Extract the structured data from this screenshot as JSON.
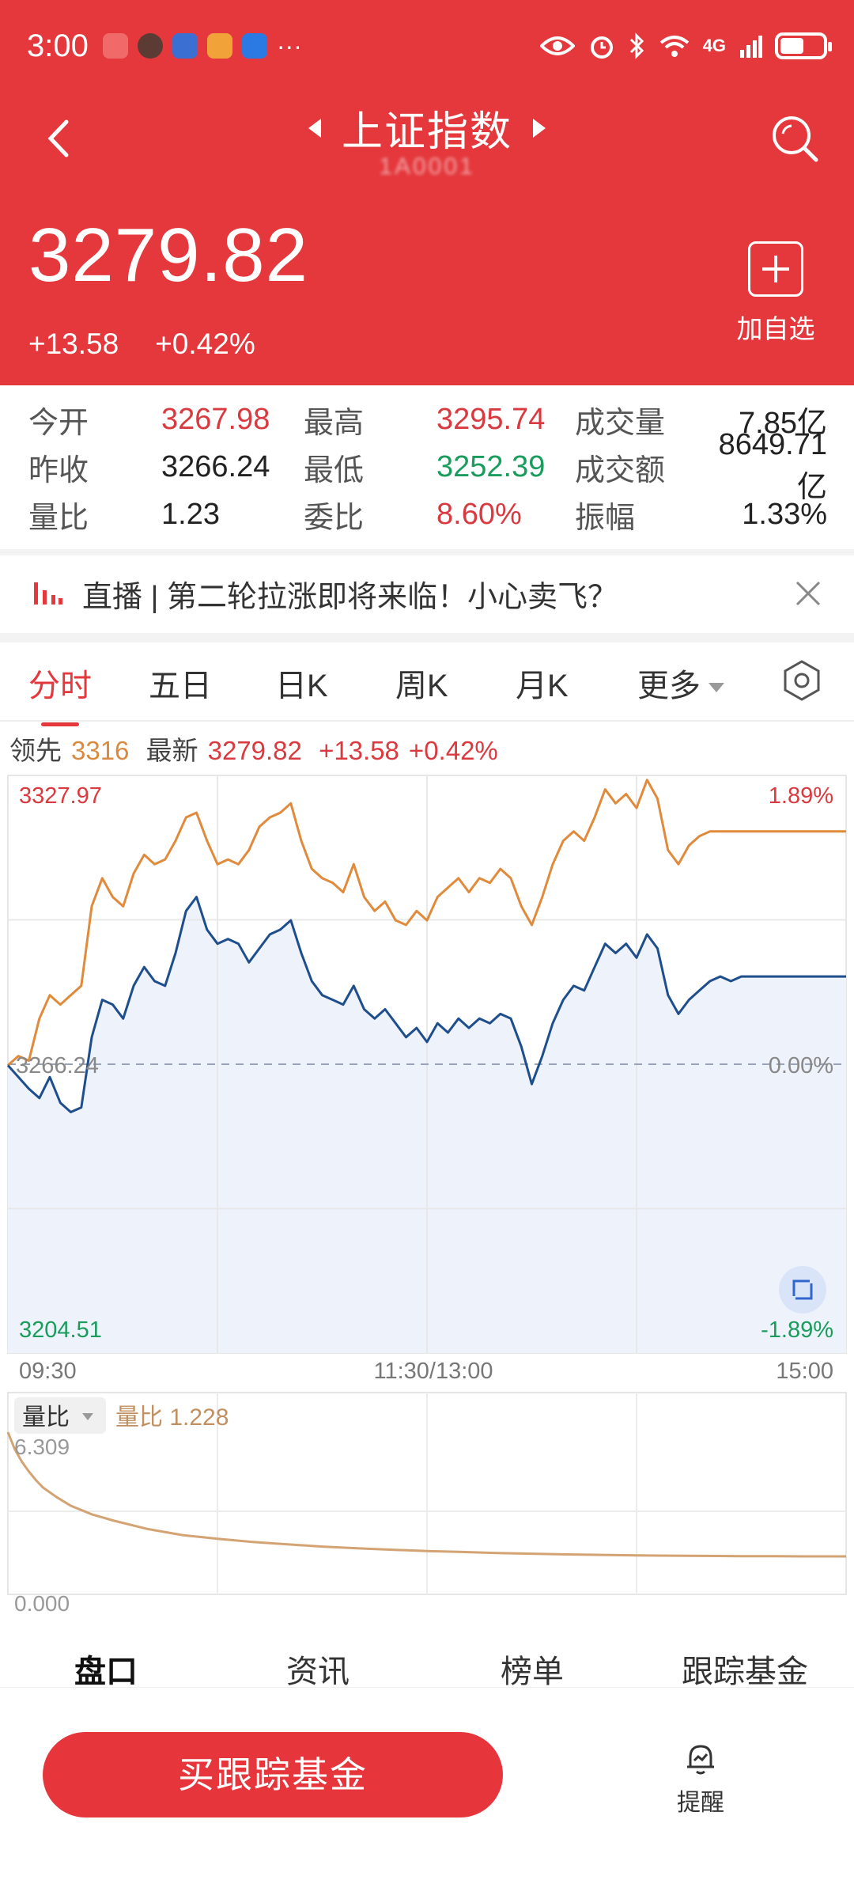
{
  "status_bar": {
    "time": "3:00",
    "dots": "···",
    "network": "4G",
    "battery_level": 0.55
  },
  "header": {
    "title": "上证指数",
    "subcode": "1A0001",
    "add_favorite_label": "加自选"
  },
  "price": {
    "current": "3279.82",
    "change": "+13.58",
    "change_pct": "+0.42%"
  },
  "quotes": [
    {
      "label": "今开",
      "value": "3267.98",
      "dir": "up",
      "label2": "最高",
      "value2": "3295.74",
      "dir2": "up",
      "label3": "成交量",
      "value3": "7.85亿"
    },
    {
      "label": "昨收",
      "value": "3266.24",
      "dir": "flat",
      "label2": "最低",
      "value2": "3252.39",
      "dir2": "down",
      "label3": "成交额",
      "value3": "8649.71亿"
    },
    {
      "label": "量比",
      "value": "1.23",
      "dir": "flat",
      "label2": "委比",
      "value2": "8.60%",
      "dir2": "up",
      "label3": "振幅",
      "value3": "1.33%"
    }
  ],
  "live_banner": {
    "text": "直播 | 第二轮拉涨即将来临！小心卖飞？"
  },
  "tabs": {
    "items": [
      "分时",
      "五日",
      "日K",
      "周K",
      "月K",
      "更多"
    ],
    "active": "分时"
  },
  "lead_line": {
    "lead_label": "领先",
    "lead_value": "3316",
    "latest_label": "最新",
    "latest_value": "3279.82",
    "change": "+13.58",
    "change_pct": "+0.42%"
  },
  "chart_labels": {
    "top_price": "3327.97",
    "mid_price": "3266.24",
    "bottom_price": "3204.51",
    "top_pct": "1.89%",
    "mid_pct": "0.00%",
    "bottom_pct": "-1.89%",
    "time_start": "09:30",
    "time_mid": "11:30/13:00",
    "time_end": "15:00",
    "sub_indicator": "量比",
    "sub_value_label": "量比 1.228",
    "sub_top": "6.309",
    "sub_bottom": "0.000"
  },
  "chart_data": [
    {
      "type": "line",
      "ylim": [
        3204.51,
        3327.97
      ],
      "xlabel_ticks": [
        "09:30",
        "11:30/13:00",
        "15:00"
      ],
      "series": [
        {
          "name": "最新",
          "color": "#1f4e8c",
          "x": [
            0,
            3,
            6,
            9,
            12,
            15,
            18,
            21,
            24,
            27,
            30,
            33,
            36,
            39,
            42,
            45,
            48,
            51,
            54,
            57,
            60,
            63,
            66,
            69,
            72,
            75,
            78,
            81,
            84,
            87,
            90,
            93,
            96,
            99,
            102,
            105,
            108,
            111,
            114,
            117,
            120,
            123,
            126,
            129,
            132,
            135,
            138,
            141,
            144,
            147,
            150,
            153,
            156,
            159,
            162,
            165,
            168,
            171,
            174,
            177,
            180,
            183,
            186,
            189,
            192,
            195,
            198,
            201,
            204,
            207,
            210,
            213,
            216,
            219,
            222,
            225,
            228,
            231,
            234,
            237,
            240
          ],
          "values": [
            3266.0,
            3263.5,
            3261.0,
            3259.0,
            3263.5,
            3258.0,
            3256.0,
            3257.0,
            3272.0,
            3280.0,
            3279.0,
            3276.0,
            3283.0,
            3287.0,
            3284.0,
            3283.0,
            3290.0,
            3299.0,
            3302.0,
            3295.0,
            3292.0,
            3293.0,
            3292.0,
            3288.0,
            3291.0,
            3294.0,
            3295.0,
            3297.0,
            3290.0,
            3284.0,
            3281.0,
            3280.0,
            3279.0,
            3283.0,
            3278.0,
            3276.0,
            3278.0,
            3275.0,
            3272.0,
            3274.0,
            3271.0,
            3275.0,
            3273.0,
            3276.0,
            3274.0,
            3276.0,
            3275.0,
            3277.0,
            3276.0,
            3270.0,
            3262.0,
            3268.0,
            3275.0,
            3280.0,
            3283.0,
            3282.0,
            3287.0,
            3292.0,
            3290.0,
            3292.0,
            3289.0,
            3294.0,
            3291.0,
            3281.0,
            3277.0,
            3280.0,
            3282.0,
            3284.0,
            3285.0,
            3284.0,
            3285.0,
            3285.0,
            3285.0,
            3285.0,
            3285.0,
            3285.0,
            3285.0,
            3285.0,
            3285.0,
            3285.0,
            3285.0
          ]
        },
        {
          "name": "领先",
          "color": "#e08a3c",
          "x": [
            0,
            3,
            6,
            9,
            12,
            15,
            18,
            21,
            24,
            27,
            30,
            33,
            36,
            39,
            42,
            45,
            48,
            51,
            54,
            57,
            60,
            63,
            66,
            69,
            72,
            75,
            78,
            81,
            84,
            87,
            90,
            93,
            96,
            99,
            102,
            105,
            108,
            111,
            114,
            117,
            120,
            123,
            126,
            129,
            132,
            135,
            138,
            141,
            144,
            147,
            150,
            153,
            156,
            159,
            162,
            165,
            168,
            171,
            174,
            177,
            180,
            183,
            186,
            189,
            192,
            195,
            198,
            201,
            204,
            207,
            210,
            213,
            216,
            219,
            222,
            225,
            228,
            231,
            234,
            237,
            240
          ],
          "values": [
            3266.0,
            3268.0,
            3267.0,
            3276.0,
            3281.0,
            3279.0,
            3281.0,
            3283.0,
            3300.0,
            3306.0,
            3302.0,
            3300.0,
            3307.0,
            3311.0,
            3309.0,
            3310.0,
            3314.0,
            3319.0,
            3320.0,
            3314.0,
            3309.0,
            3310.0,
            3309.0,
            3312.0,
            3317.0,
            3319.0,
            3320.0,
            3322.0,
            3314.0,
            3308.0,
            3306.0,
            3305.0,
            3303.0,
            3309.0,
            3302.0,
            3299.0,
            3301.0,
            3297.0,
            3296.0,
            3299.0,
            3297.0,
            3302.0,
            3304.0,
            3306.0,
            3303.0,
            3306.0,
            3305.0,
            3308.0,
            3306.0,
            3300.0,
            3296.0,
            3302.0,
            3309.0,
            3314.0,
            3316.0,
            3314.0,
            3319.0,
            3325.0,
            3322.0,
            3324.0,
            3321.0,
            3327.0,
            3323.0,
            3312.0,
            3309.0,
            3313.0,
            3315.0,
            3316.0,
            3316.0,
            3316.0,
            3316.0,
            3316.0,
            3316.0,
            3316.0,
            3316.0,
            3316.0,
            3316.0,
            3316.0,
            3316.0,
            3316.0,
            3316.0
          ]
        }
      ]
    },
    {
      "type": "line",
      "ylim": [
        0.0,
        6.309
      ],
      "series": [
        {
          "name": "量比",
          "color": "#d4a373",
          "x": [
            0,
            2,
            4,
            6,
            8,
            10,
            14,
            18,
            24,
            30,
            40,
            50,
            60,
            70,
            80,
            90,
            100,
            110,
            120,
            130,
            140,
            150,
            160,
            170,
            180,
            190,
            200,
            210,
            220,
            230,
            240
          ],
          "values": [
            6.309,
            5.6,
            5.1,
            4.7,
            4.35,
            4.05,
            3.65,
            3.3,
            2.95,
            2.7,
            2.35,
            2.1,
            1.95,
            1.82,
            1.72,
            1.63,
            1.56,
            1.5,
            1.45,
            1.41,
            1.37,
            1.34,
            1.31,
            1.29,
            1.27,
            1.26,
            1.25,
            1.24,
            1.235,
            1.23,
            1.228
          ]
        }
      ]
    }
  ],
  "bottom_tabs": [
    "盘口",
    "资讯",
    "榜单",
    "跟踪基金"
  ],
  "footer": {
    "buy_label": "买跟踪基金",
    "remind_label": "提醒"
  },
  "colors": {
    "brand_red": "#e4383c",
    "up": "#d93a3f",
    "down": "#1a9c5c",
    "lead_orange": "#d98a40"
  }
}
